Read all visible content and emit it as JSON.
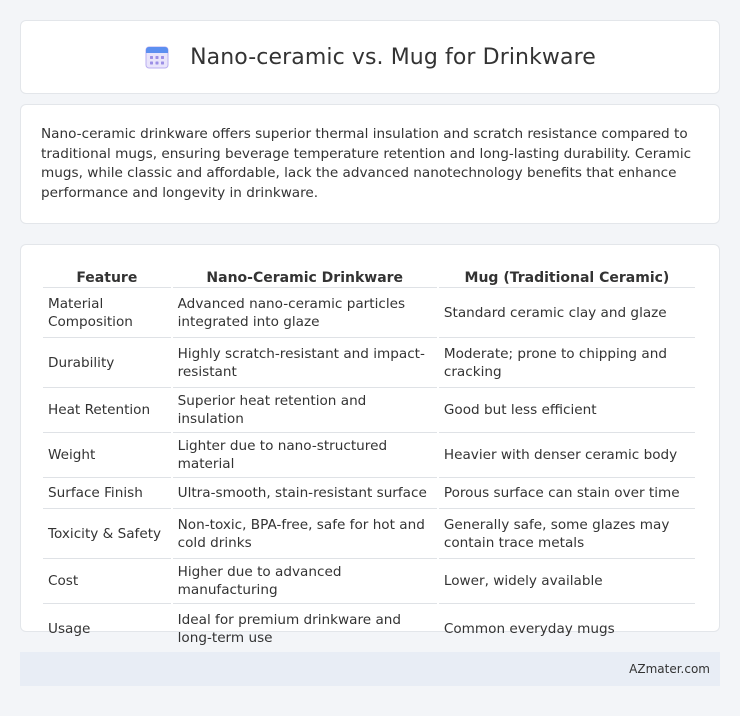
{
  "header": {
    "title": "Nano-ceramic vs. Mug for Drinkware",
    "icon": "calendar-icon"
  },
  "summary": {
    "text": "Nano-ceramic drinkware offers superior thermal insulation and scratch resistance compared to traditional mugs, ensuring beverage temperature retention and long-lasting durability. Ceramic mugs, while classic and affordable, lack the advanced nanotechnology benefits that enhance performance and longevity in drinkware."
  },
  "table": {
    "headers": [
      "Feature",
      "Nano-Ceramic Drinkware",
      "Mug (Traditional Ceramic)"
    ],
    "rows": [
      {
        "feature": "Material Composition",
        "nano": "Advanced nano-ceramic particles integrated into glaze",
        "mug": "Standard ceramic clay and glaze"
      },
      {
        "feature": "Durability",
        "nano": "Highly scratch-resistant and impact-resistant",
        "mug": "Moderate; prone to chipping and cracking"
      },
      {
        "feature": "Heat Retention",
        "nano": "Superior heat retention and insulation",
        "mug": "Good but less efficient"
      },
      {
        "feature": "Weight",
        "nano": "Lighter due to nano-structured material",
        "mug": "Heavier with denser ceramic body"
      },
      {
        "feature": "Surface Finish",
        "nano": "Ultra-smooth, stain-resistant surface",
        "mug": "Porous surface can stain over time"
      },
      {
        "feature": "Toxicity & Safety",
        "nano": "Non-toxic, BPA-free, safe for hot and cold drinks",
        "mug": "Generally safe, some glazes may contain trace metals"
      },
      {
        "feature": "Cost",
        "nano": "Higher due to advanced manufacturing",
        "mug": "Lower, widely available"
      },
      {
        "feature": "Usage",
        "nano": "Ideal for premium drinkware and long-term use",
        "mug": "Common everyday mugs"
      }
    ]
  },
  "footer": {
    "brand": "AZmater.com"
  }
}
